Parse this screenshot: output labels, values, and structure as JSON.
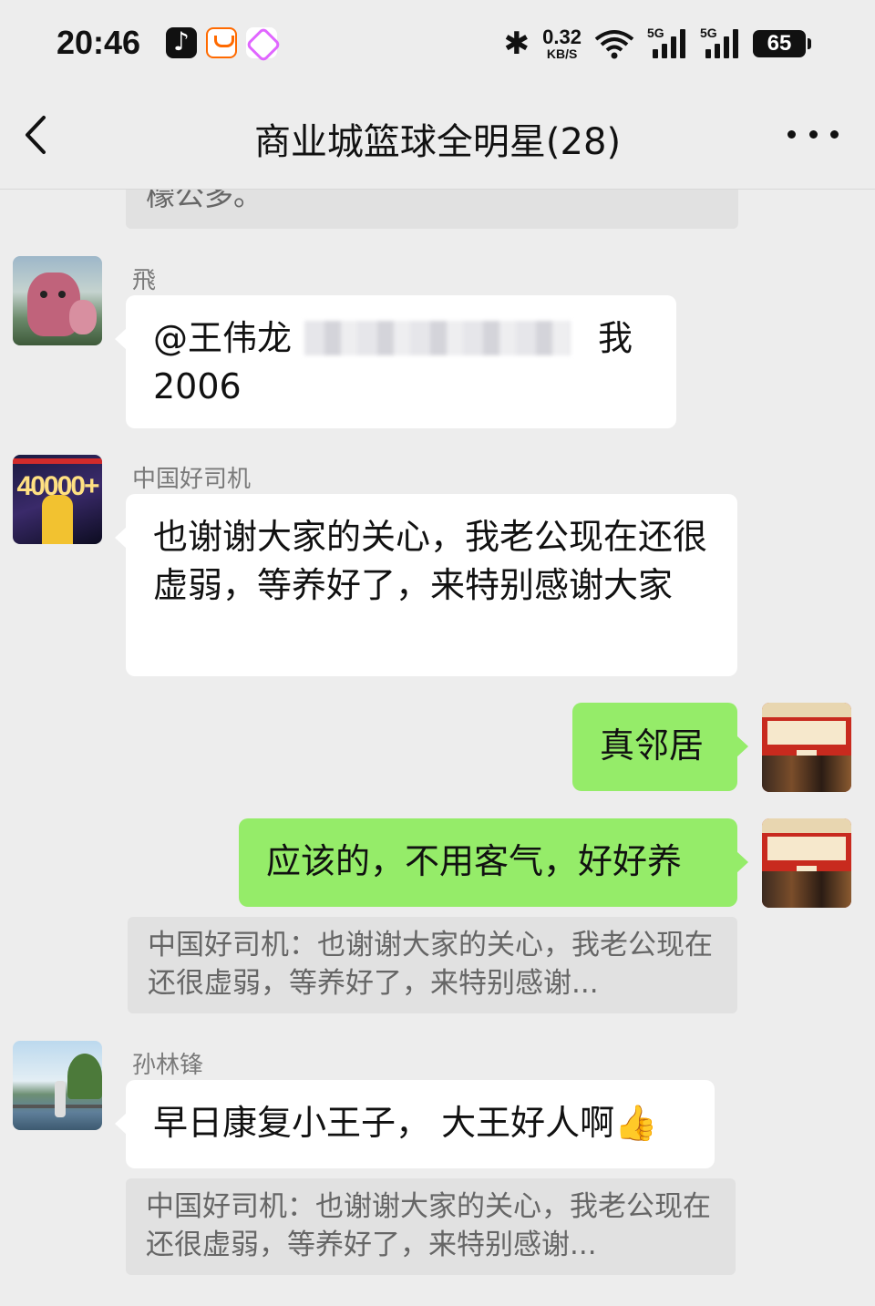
{
  "status_bar": {
    "time": "20:46",
    "net_speed_value": "0.32",
    "net_speed_unit": "KB/S",
    "signal1_label": "5G",
    "signal2_label": "5G",
    "battery": "65",
    "app_icons": [
      "tiktok-icon",
      "taobao-icon",
      "app-icon"
    ]
  },
  "nav": {
    "title": "商业城篮球全明星(28)"
  },
  "messages": {
    "top_quote": "檬公多。",
    "msg1": {
      "sender": "飛",
      "line1_mention": "@王伟龙",
      "line1_tail": "我",
      "line2": "2006"
    },
    "msg2": {
      "sender": "中国好司机",
      "text": "也谢谢大家的关心，我老公现在还很虚弱，等养好了，来特别感谢大家",
      "avatar_text": "40000+"
    },
    "msg3": {
      "text": "真邻居"
    },
    "msg4": {
      "text": "应该的，不用客气，好好养",
      "quote": "中国好司机：也谢谢大家的关心，我老公现在还很虚弱，等养好了，来特别感谢..."
    },
    "msg5": {
      "sender": "孙林锋",
      "text": "早日康复小王子， 大王好人啊",
      "emoji": "👍",
      "quote": "中国好司机：也谢谢大家的关心，我老公现在还很虚弱，等养好了，来特别感谢..."
    }
  },
  "colors": {
    "background": "#ededed",
    "bubble_self": "#95ec69",
    "bubble_other": "#ffffff",
    "quote_bg": "#e1e1e1"
  }
}
